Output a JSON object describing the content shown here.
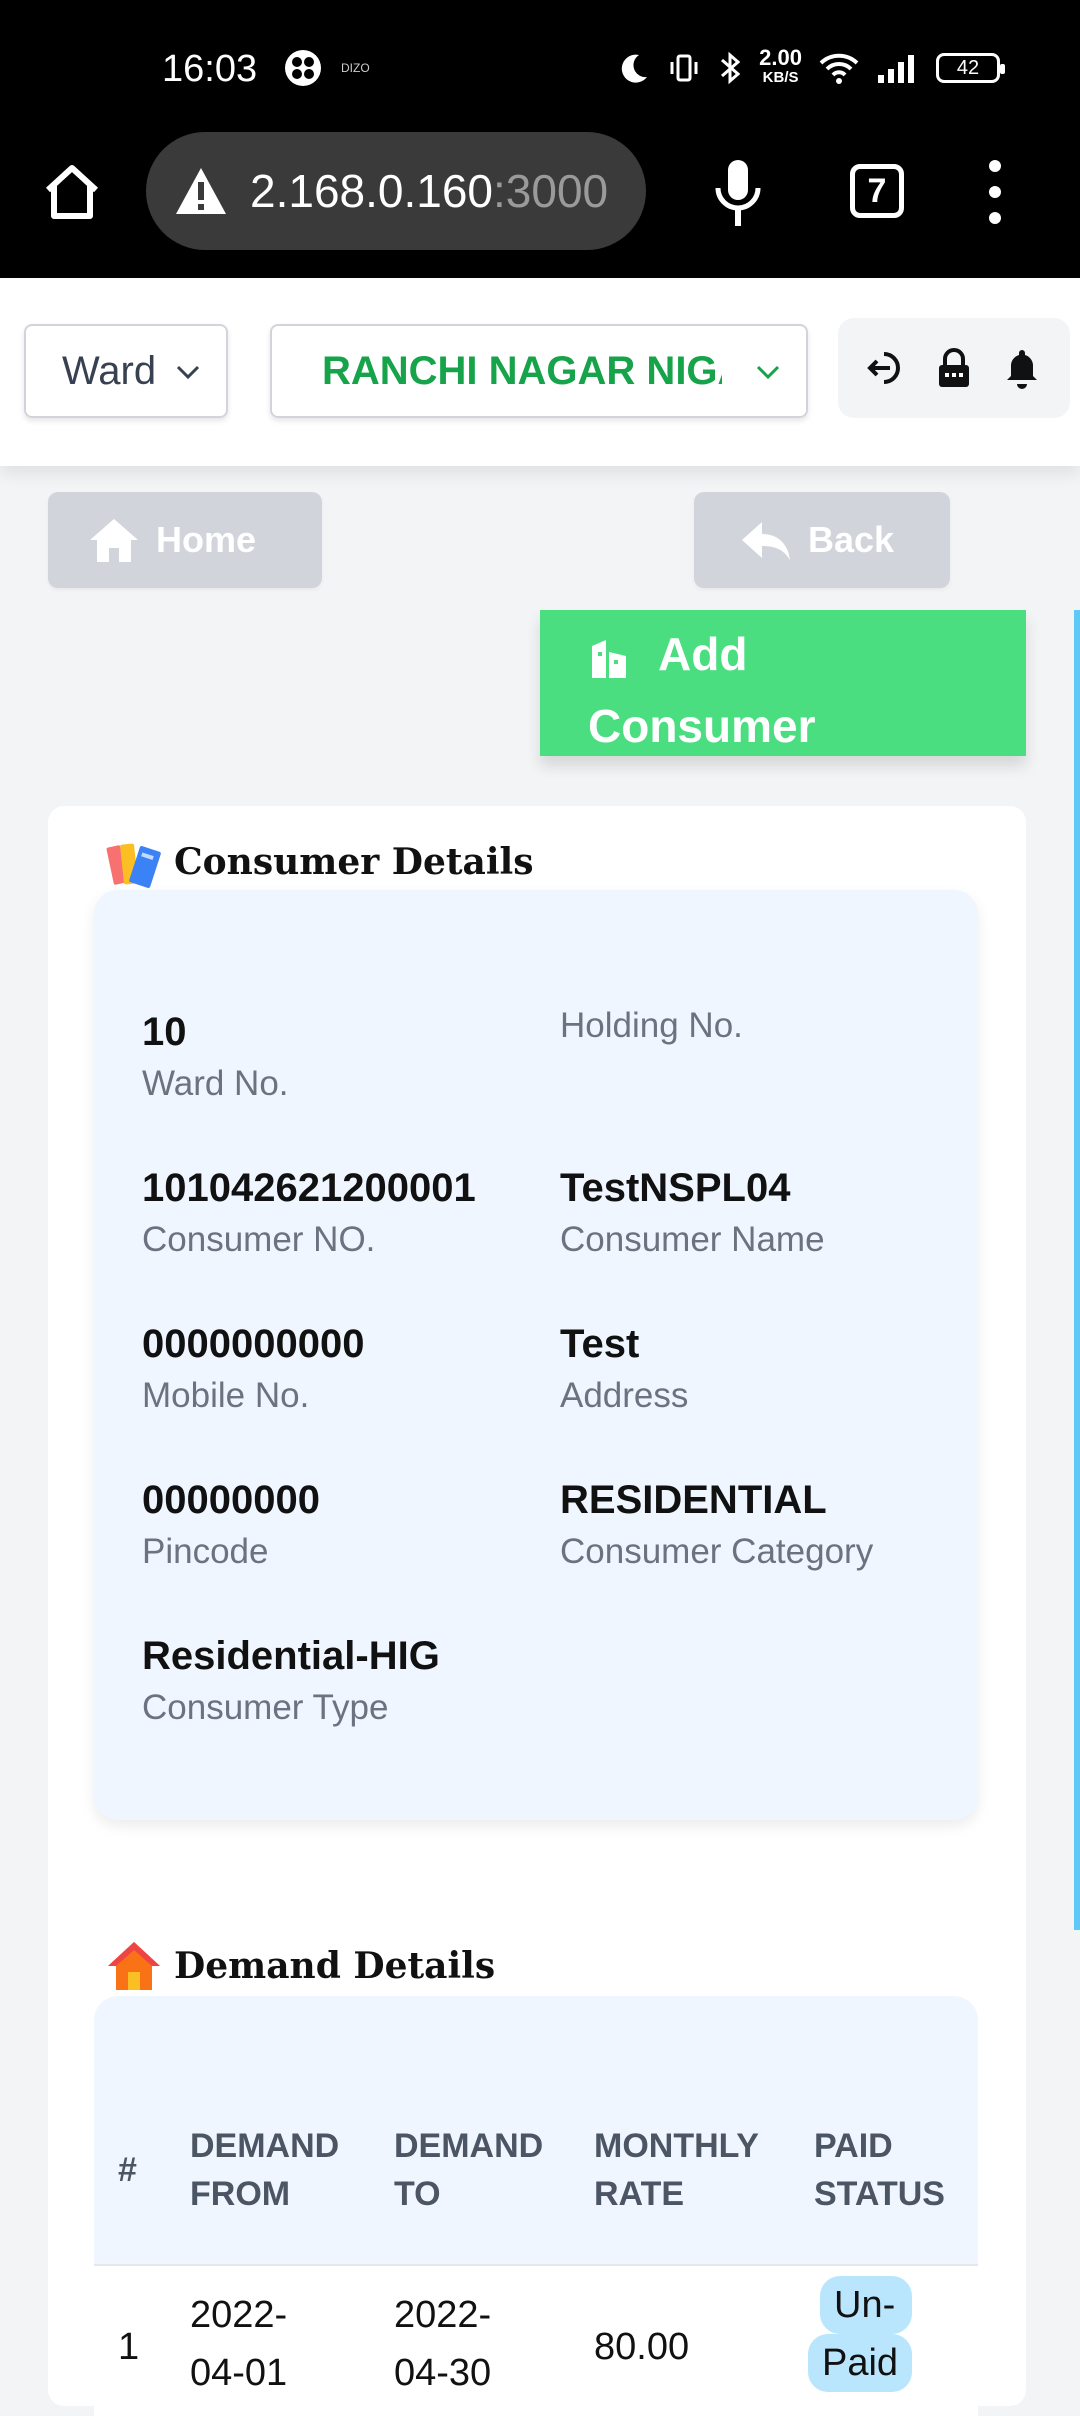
{
  "status_bar": {
    "time": "16:03",
    "carrier_label": "DIZO",
    "net_speed_value": "2.00",
    "net_speed_unit": "KB/S",
    "battery": "42"
  },
  "browser": {
    "url_host": "2.168.0.160",
    "url_port": ":3000",
    "tabs_count": "7"
  },
  "top_nav": {
    "ward_select_value": "Ward",
    "ulb_select_value": "RANCHI NAGAR NIGAM"
  },
  "actions": {
    "home_label": "Home",
    "back_label": "Back",
    "add_consumer_label_line1": "Add",
    "add_consumer_label_line2": "Consumer"
  },
  "consumer_details": {
    "title": "Consumer Details",
    "fields": [
      {
        "value": "10",
        "label": "Ward No."
      },
      {
        "value": "",
        "label": "Holding No."
      },
      {
        "value": "101042621200001",
        "label": "Consumer NO."
      },
      {
        "value": "TestNSPL04",
        "label": "Consumer Name"
      },
      {
        "value": "0000000000",
        "label": "Mobile No."
      },
      {
        "value": "Test",
        "label": "Address"
      },
      {
        "value": "00000000",
        "label": "Pincode"
      },
      {
        "value": "RESIDENTIAL",
        "label": "Consumer Category"
      },
      {
        "value": "Residential-HIG",
        "label": "Consumer Type"
      }
    ]
  },
  "demand_details": {
    "title": "Demand Details",
    "columns": {
      "index": "#",
      "demand_from_1": "DEMAND",
      "demand_from_2": "FROM",
      "demand_to_1": "DEMAND",
      "demand_to_2": "TO",
      "monthly_rate_1": "MONTHLY",
      "monthly_rate_2": "RATE",
      "paid_status_1": "PAID",
      "paid_status_2": "STATUS"
    },
    "rows": [
      {
        "index": "1",
        "from_1": "2022-",
        "from_2": "04-01",
        "to_1": "2022-",
        "to_2": "04-30",
        "rate": "80.00",
        "status_1": "Un-",
        "status_2": "Paid"
      }
    ]
  },
  "colors": {
    "accent_green": "#4ade80",
    "ulb_text_green": "#16a34a",
    "card_bg": "#eff6ff",
    "badge_bg": "#bae6fd"
  }
}
